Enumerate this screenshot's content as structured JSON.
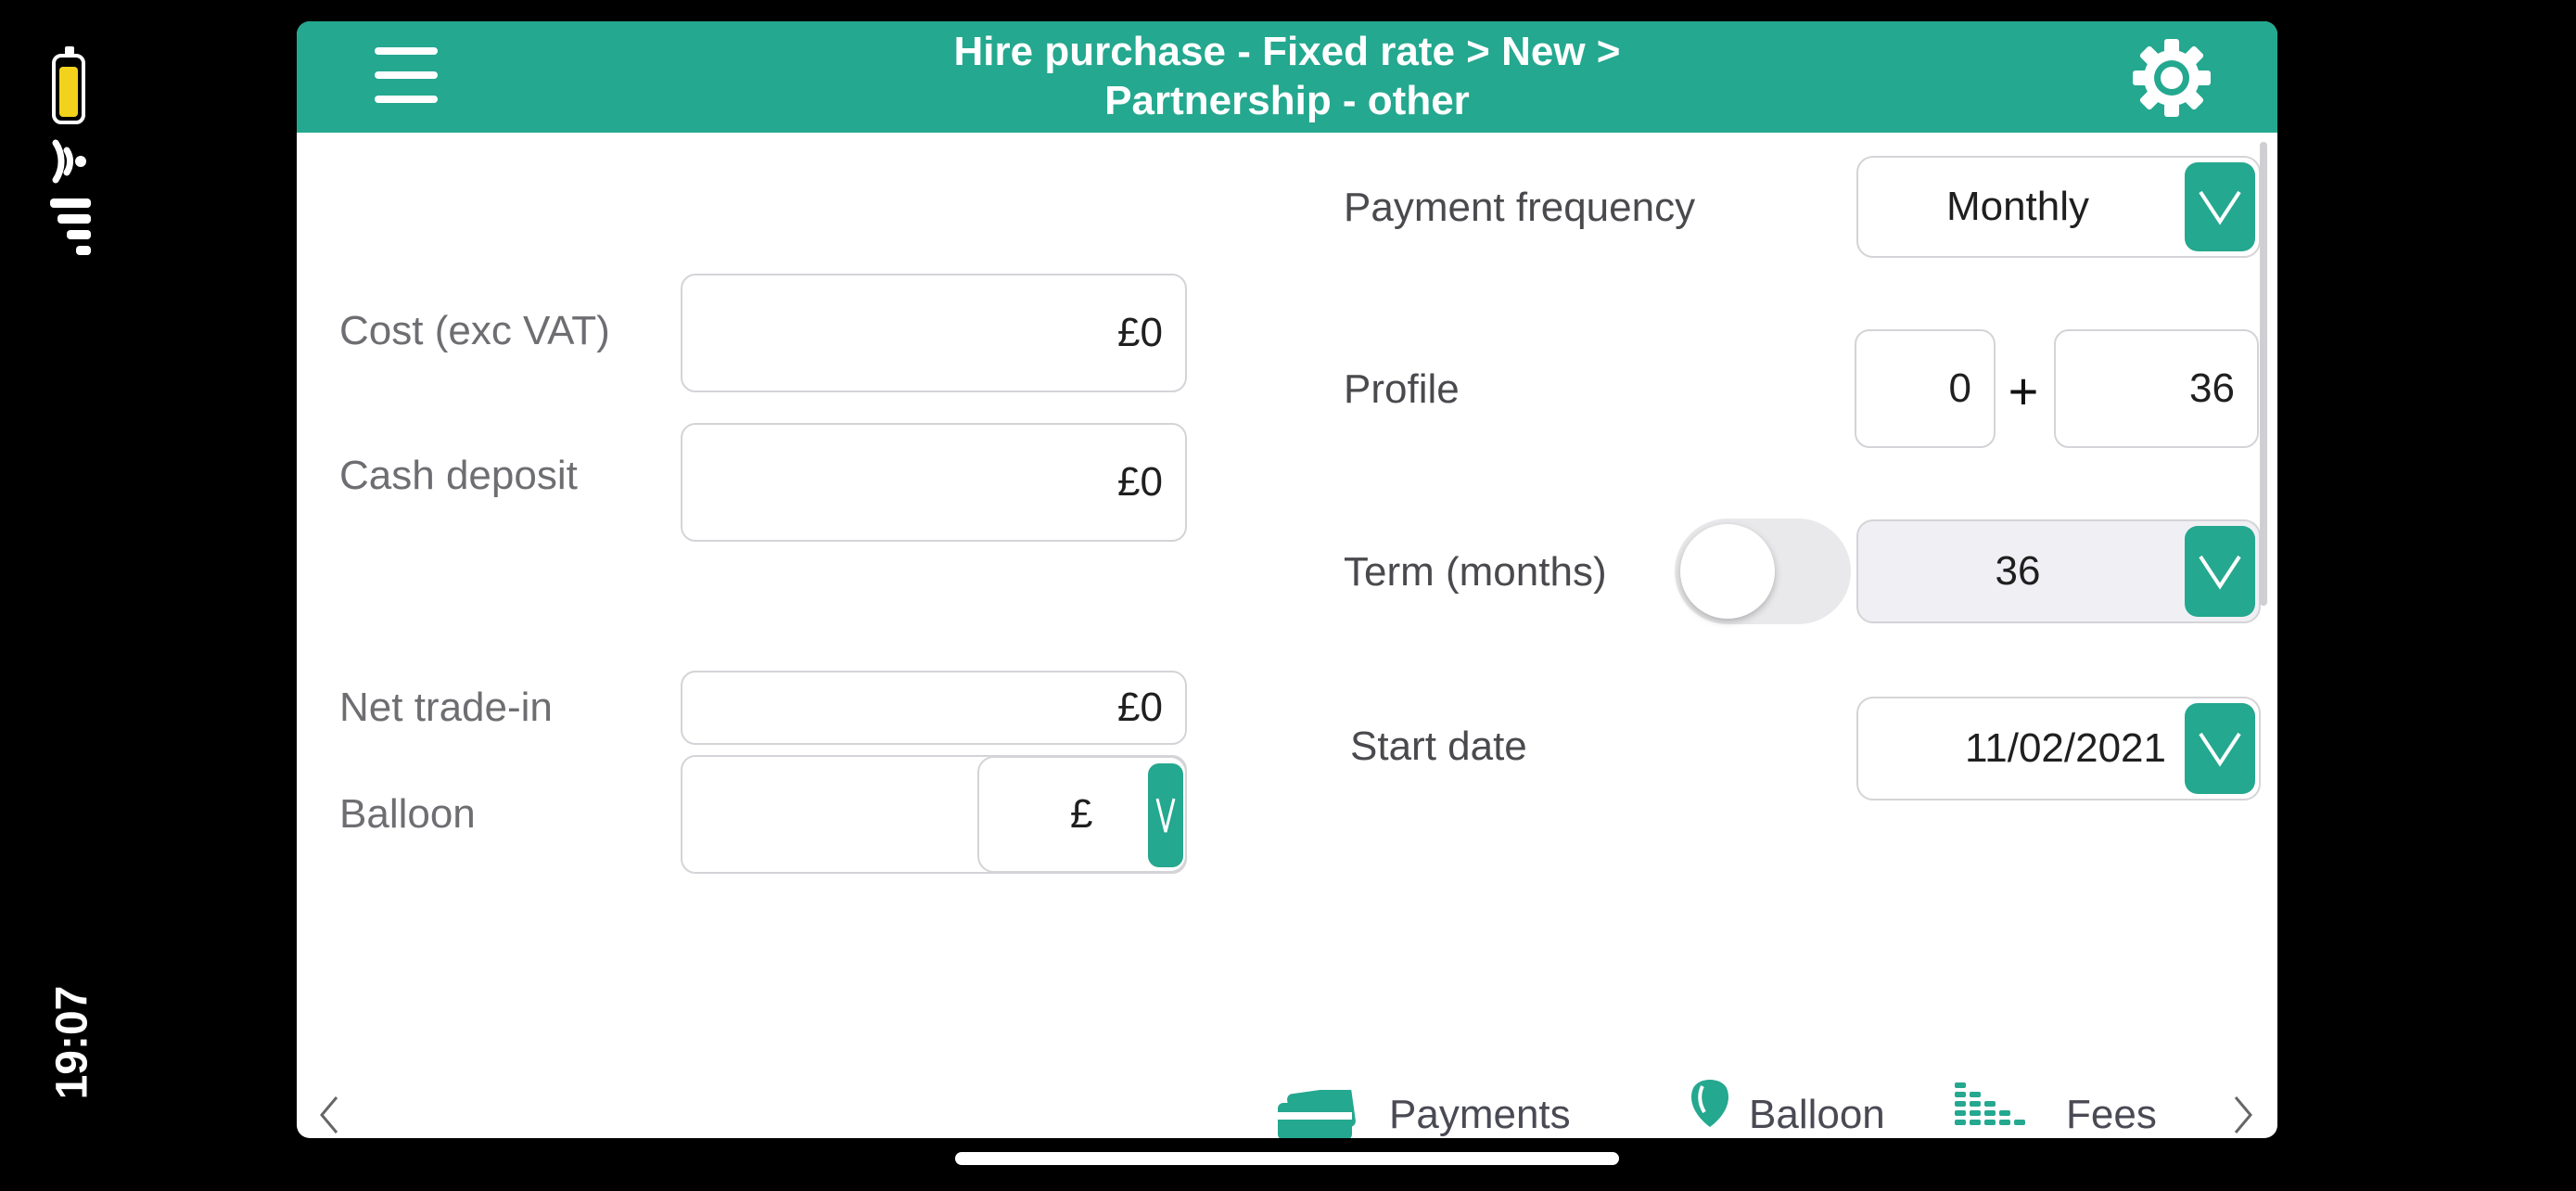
{
  "status_bar": {
    "time": "19:07",
    "battery_icon": "battery-icon",
    "wifi_icon": "wifi-icon",
    "signal_icon": "cellular-signal-icon"
  },
  "header": {
    "title_line1": "Hire purchase - Fixed rate > New >",
    "title_line2": "Partnership - other",
    "menu_icon": "hamburger-menu-icon",
    "settings_icon": "gear-icon",
    "color": "#24a88f"
  },
  "left": {
    "cost_label": "Cost (exc VAT)",
    "cost_value": "£0",
    "deposit_label": "Cash deposit",
    "deposit_value": "£0",
    "tradein_label": "Net trade-in",
    "tradein_value": "£0",
    "balloon_label": "Balloon",
    "balloon_value": "",
    "balloon_unit": "£"
  },
  "right": {
    "frequency_label": "Payment frequency",
    "frequency_value": "Monthly",
    "profile_label": "Profile",
    "profile_upfront": "0",
    "profile_plus": "+",
    "profile_regular": "36",
    "term_label": "Term (months)",
    "term_value": "36",
    "term_toggle_on": false,
    "start_label": "Start date",
    "start_value": "11/02/2021"
  },
  "bottom_nav": {
    "items": [
      {
        "label": "Payments",
        "icon": "credit-card-icon"
      },
      {
        "label": "Balloon",
        "icon": "balloon-icon"
      },
      {
        "label": "Fees",
        "icon": "coin-stacks-icon"
      }
    ],
    "prev_icon": "chevron-left-icon",
    "next_icon": "chevron-right-icon"
  }
}
